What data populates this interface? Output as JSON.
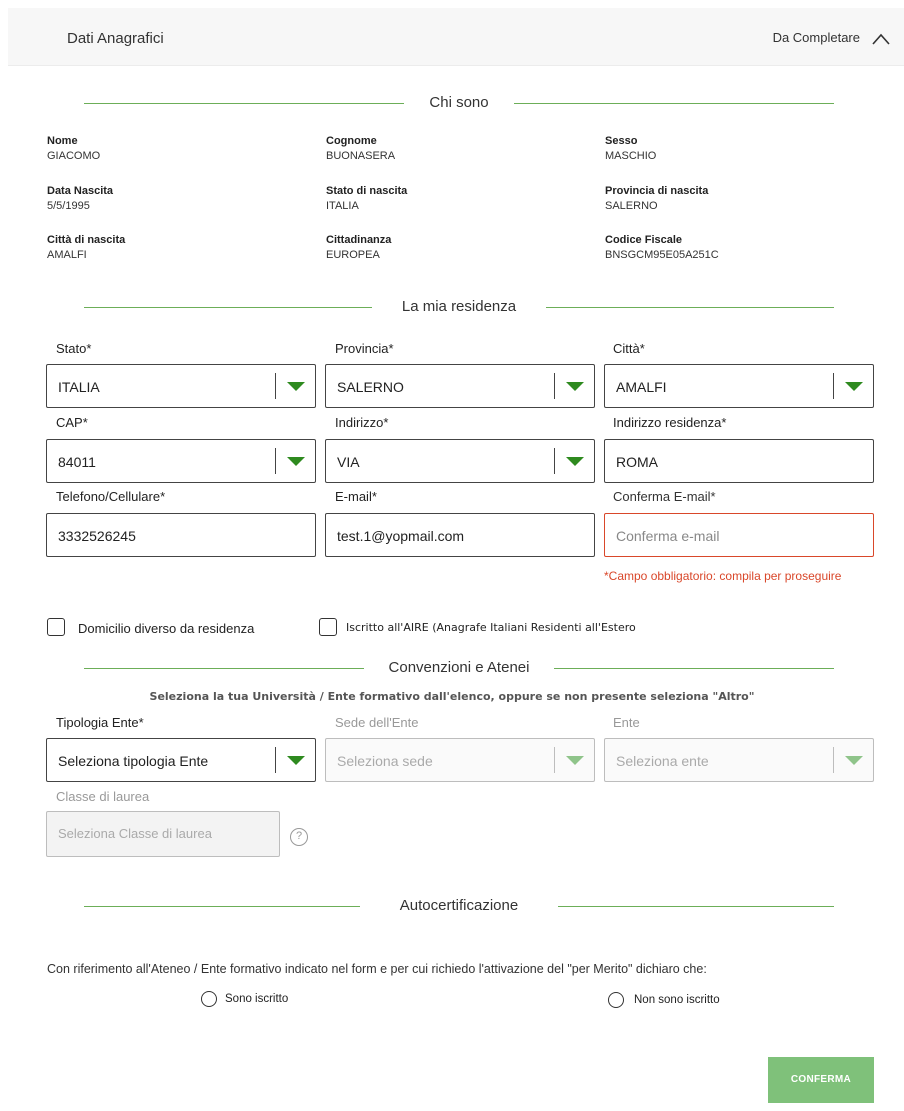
{
  "header": {
    "title": "Dati Anagrafici",
    "status": "Da Completare",
    "toggle_icon": "chevron-up-icon"
  },
  "sections": {
    "chi_sono": "Chi sono",
    "residenza": "La mia residenza",
    "convenzioni": "Convenzioni e Atenei",
    "autocert": "Autocertificazione"
  },
  "personal": [
    {
      "label": "Nome",
      "value": "GIACOMO"
    },
    {
      "label": "Cognome",
      "value": "BUONASERA"
    },
    {
      "label": "Sesso",
      "value": "MASCHIO"
    },
    {
      "label": "Data Nascita",
      "value": "5/5/1995"
    },
    {
      "label": "Stato di nascita",
      "value": "ITALIA"
    },
    {
      "label": "Provincia di nascita",
      "value": "SALERNO"
    },
    {
      "label": "Città di nascita",
      "value": "AMALFI"
    },
    {
      "label": "Cittadinanza",
      "value": "EUROPEA"
    },
    {
      "label": "Codice Fiscale",
      "value": "BNSGCM95E05A251C"
    }
  ],
  "residence": {
    "stato": {
      "label": "Stato*",
      "value": "ITALIA"
    },
    "provincia": {
      "label": "Provincia*",
      "value": "SALERNO"
    },
    "citta": {
      "label": "Città*",
      "value": "AMALFI"
    },
    "cap": {
      "label": "CAP*",
      "value": "84011"
    },
    "indirizzo": {
      "label": "Indirizzo*",
      "value": "VIA"
    },
    "indirizzo_res": {
      "label": "Indirizzo residenza*",
      "value": "ROMA"
    },
    "telefono": {
      "label": "Telefono/Cellulare*",
      "value": "3332526245"
    },
    "email": {
      "label": "E-mail*",
      "value": "test.1@yopmail.com"
    },
    "conferma_email": {
      "label": "Conferma E-mail*",
      "placeholder": "Conferma e-mail",
      "error": "*Campo obbligatorio: compila per proseguire"
    }
  },
  "checkboxes": {
    "domicilio": "Domicilio diverso da residenza",
    "aire": "Iscritto all'AIRE (Anagrafe Italiani Residenti all'Estero"
  },
  "convenzioni": {
    "note": "Seleziona la tua Università / Ente formativo dall'elenco, oppure se non presente seleziona \"Altro\"",
    "tipologia": {
      "label": "Tipologia Ente*",
      "placeholder": "Seleziona tipologia Ente"
    },
    "sede": {
      "label": "Sede dell'Ente",
      "placeholder": "Seleziona sede"
    },
    "ente": {
      "label": "Ente",
      "placeholder": "Seleziona ente"
    },
    "classe": {
      "label": "Classe di laurea",
      "placeholder": "Seleziona Classe di laurea"
    },
    "help_symbol": "?"
  },
  "autocert": {
    "text": "Con riferimento all'Ateneo / Ente formativo indicato nel form e per cui richiedo l'attivazione del \"per Merito\" dichiaro che:",
    "option_1": "Sono iscritto",
    "option_2": "Non sono iscritto"
  },
  "confirm_button": "CONFERMA",
  "colors": {
    "accent": "#6cae58",
    "caret": "#2e8a1f",
    "error": "#d9472a",
    "button": "#7fc17a"
  }
}
